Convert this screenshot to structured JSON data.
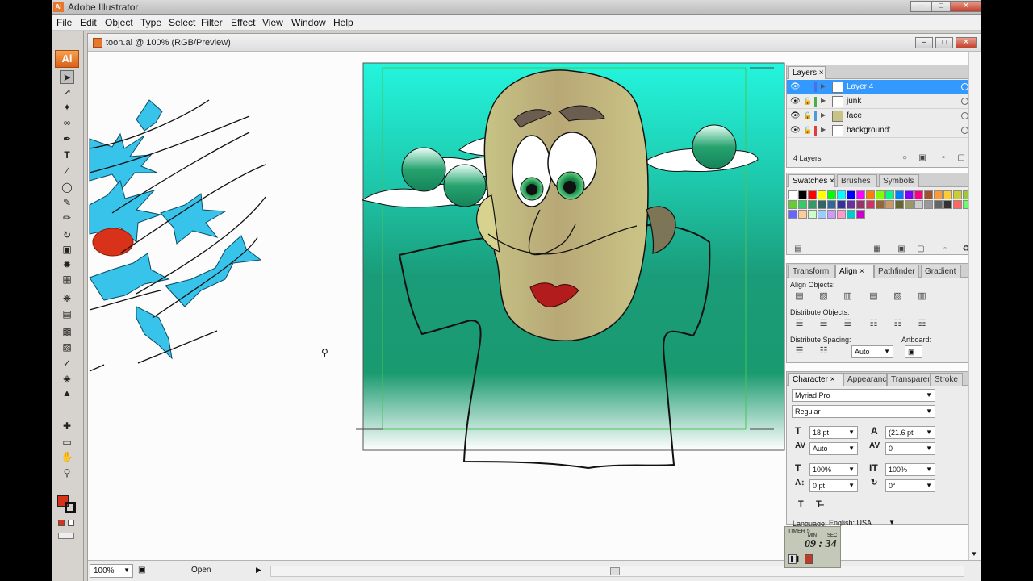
{
  "app": {
    "title": "Adobe Illustrator",
    "logo": "Ai",
    "window_controls": [
      "minimize",
      "maximize",
      "close"
    ]
  },
  "menu": [
    "File",
    "Edit",
    "Object",
    "Type",
    "Select",
    "Filter",
    "Effect",
    "View",
    "Window",
    "Help"
  ],
  "toolbox": {
    "logo": "Ai",
    "tools": [
      "selection-tool-icon",
      "direct-selection-tool-icon",
      "magic-wand-icon",
      "lasso-icon",
      "pen-tool-icon",
      "type-tool-icon",
      "line-tool-icon",
      "ellipse-tool-icon",
      "paintbrush-icon",
      "pencil-icon",
      "rotate-icon",
      "scale-icon",
      "warp-icon",
      "free-transform-icon",
      "symbol-sprayer-icon",
      "graph-icon",
      "mesh-icon",
      "gradient-icon",
      "eyedropper-icon",
      "blend-icon",
      "live-paint-icon",
      "slice-icon",
      "eraser-icon",
      "hand-icon",
      "zoom-icon"
    ],
    "fill_color": "#d8331a",
    "stroke_color": "#111111"
  },
  "document": {
    "tab_title": "toon.ai @ 100% (RGB/Preview)"
  },
  "status": {
    "zoom": "100%",
    "text": "Open"
  },
  "layers_panel": {
    "tab": "Layers",
    "layers": [
      {
        "name": "Layer 4",
        "color": "#4a6fe0",
        "selected": true
      },
      {
        "name": "junk",
        "color": "#4aae4a",
        "selected": false
      },
      {
        "name": "face",
        "color": "#4a9bd8",
        "selected": false
      },
      {
        "name": "background'",
        "color": "#e23b3b",
        "selected": false
      }
    ],
    "count_label": "4 Layers"
  },
  "swatches_panel": {
    "tabs": [
      "Swatches",
      "Brushes",
      "Symbols"
    ],
    "colors": [
      "#ffffff",
      "#000000",
      "#ff0000",
      "#ffff00",
      "#00ff00",
      "#00ffff",
      "#0000ff",
      "#ff00ff",
      "#ff8000",
      "#80ff00",
      "#00ff80",
      "#0080ff",
      "#8000ff",
      "#ff0080",
      "#a0522d",
      "#ff9933",
      "#ffcc33",
      "#cccc33",
      "#99cc33",
      "#66cc33",
      "#33cc66",
      "#339966",
      "#336666",
      "#336699",
      "#333399",
      "#663399",
      "#993366",
      "#cc3366",
      "#996633",
      "#cc9966",
      "#666633",
      "#999966",
      "#cccccc",
      "#999999",
      "#666666",
      "#333333",
      "#ff6666",
      "#66ff66",
      "#6666ff",
      "#ffcc99",
      "#ccffcc",
      "#99ccff",
      "#cc99ff",
      "#ff99cc",
      "#00cccc",
      "#cc00cc"
    ]
  },
  "align_panel": {
    "tabs": [
      "Transform",
      "Align",
      "Pathfinder",
      "Gradient"
    ],
    "align_objects_label": "Align Objects:",
    "distribute_objects_label": "Distribute Objects:",
    "distribute_spacing_label": "Distribute Spacing:",
    "artboard_label": "Artboard:",
    "spacing_value": "Auto"
  },
  "character_panel": {
    "tabs": [
      "Character",
      "Appearance",
      "Transparency",
      "Stroke"
    ],
    "font_family": "Myriad Pro",
    "font_style": "Regular",
    "font_size": "18 pt",
    "leading": "(21.6 pt",
    "kerning": "Auto",
    "tracking": "0",
    "vertical_scale": "100%",
    "horizontal_scale": "100%",
    "baseline_shift": "0 pt",
    "rotation": "0°",
    "language_label": "Language:",
    "language": "English: USA"
  },
  "timer": {
    "title": "TIMER 5",
    "min_label": "MIN",
    "sec_label": "SEC",
    "value": "09 : 34"
  }
}
